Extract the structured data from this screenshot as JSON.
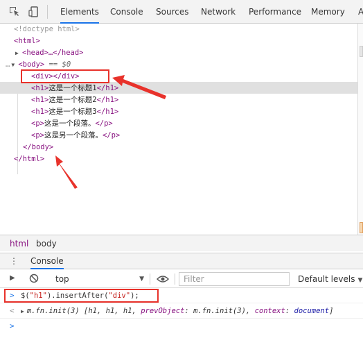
{
  "toolbar": {
    "tabs": [
      "Elements",
      "Console",
      "Sources",
      "Network",
      "Performance",
      "Memory",
      "A"
    ]
  },
  "tree": {
    "doctype": "<!doctype html>",
    "html_open": "<html>",
    "head": "<head>…</head>",
    "body_open": "<body>",
    "body_eq": " == $0",
    "ellipsis": "…",
    "div": "<div></div>",
    "h1_open": "<h1>",
    "h1_close": "</h1>",
    "h1_texts": [
      "这是一个标题1",
      "这是一个标题2",
      "这是一个标题3"
    ],
    "p_open": "<p>",
    "p_close": "</p>",
    "p_texts": [
      "这是一个段落。",
      "这是另一个段落。"
    ],
    "body_close": "</body>",
    "html_close": "</html>"
  },
  "breadcrumb": [
    "html",
    "body"
  ],
  "drawer": {
    "tab": "Console",
    "context": "top",
    "filter_placeholder": "Filter",
    "levels": "Default levels"
  },
  "console": {
    "input_prefix": "$(",
    "input_arg1": "\"h1\"",
    "input_mid": ").insertAfter(",
    "input_arg2": "\"div\"",
    "input_suffix": ");",
    "result_head": "m.fn.init(3) [",
    "result_items": "h1, h1, h1, ",
    "result_key1": "prevObject",
    "result_val1": ": m.fn.init(3), ",
    "result_key2": "context",
    "result_val2": ": ",
    "result_doc": "document",
    "result_tail": "]"
  },
  "colors": {
    "tag": "#881280",
    "annotation_red": "#e8322b",
    "accent": "#1a73e8"
  }
}
